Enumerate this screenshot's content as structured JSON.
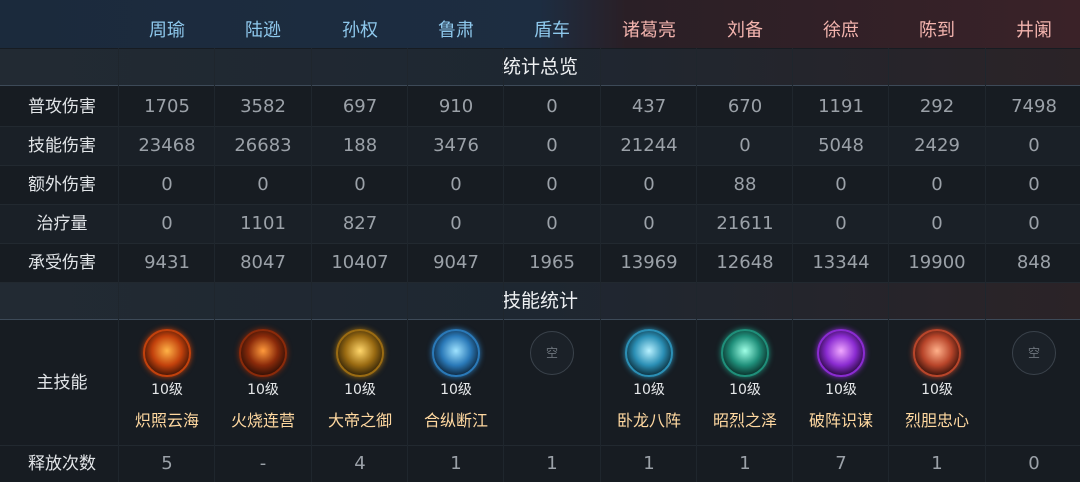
{
  "generals": [
    {
      "name": "周瑜",
      "side": "wei"
    },
    {
      "name": "陆逊",
      "side": "wei"
    },
    {
      "name": "孙权",
      "side": "wei"
    },
    {
      "name": "鲁肃",
      "side": "wei"
    },
    {
      "name": "盾车",
      "side": "wei"
    },
    {
      "name": "诸葛亮",
      "side": "shu"
    },
    {
      "name": "刘备",
      "side": "shu"
    },
    {
      "name": "徐庶",
      "side": "shu"
    },
    {
      "name": "陈到",
      "side": "shu"
    },
    {
      "name": "井阑",
      "side": "shu"
    }
  ],
  "sections": {
    "overview": "统计总览",
    "skills": "技能统计"
  },
  "stats": [
    {
      "label": "普攻伤害",
      "values": [
        "1705",
        "3582",
        "697",
        "910",
        "0",
        "437",
        "670",
        "1191",
        "292",
        "7498"
      ]
    },
    {
      "label": "技能伤害",
      "values": [
        "23468",
        "26683",
        "188",
        "3476",
        "0",
        "21244",
        "0",
        "5048",
        "2429",
        "0"
      ]
    },
    {
      "label": "额外伤害",
      "values": [
        "0",
        "0",
        "0",
        "0",
        "0",
        "0",
        "88",
        "0",
        "0",
        "0"
      ]
    },
    {
      "label": "治疗量",
      "values": [
        "0",
        "1101",
        "827",
        "0",
        "0",
        "0",
        "21611",
        "0",
        "0",
        "0"
      ]
    },
    {
      "label": "承受伤害",
      "values": [
        "9431",
        "8047",
        "10407",
        "9047",
        "1965",
        "13969",
        "12648",
        "13344",
        "19900",
        "848"
      ]
    }
  ],
  "main_skill": {
    "label": "主技能",
    "skills": [
      {
        "icon": "fire-vortex-icon",
        "level": "10级",
        "name": "炽照云海",
        "empty": false,
        "colors": [
          "#ffb347",
          "#c2410c",
          "#3a1206"
        ]
      },
      {
        "icon": "burning-camp-icon",
        "level": "10级",
        "name": "火烧连营",
        "empty": false,
        "colors": [
          "#ff9a3c",
          "#8a2a0a",
          "#2a0e06"
        ]
      },
      {
        "icon": "emperor-guard-icon",
        "level": "10级",
        "name": "大帝之御",
        "empty": false,
        "colors": [
          "#ffd66b",
          "#9a6b12",
          "#2d2008"
        ]
      },
      {
        "icon": "alliance-diamond-icon",
        "level": "10级",
        "name": "合纵断江",
        "empty": false,
        "colors": [
          "#9fe3ff",
          "#2a79b8",
          "#0d2236"
        ]
      },
      {
        "icon": "empty-slot-icon",
        "level": "",
        "name": "",
        "empty": true,
        "empty_text": "空"
      },
      {
        "icon": "sleeping-dragon-icon",
        "level": "10级",
        "name": "卧龙八阵",
        "empty": false,
        "colors": [
          "#b8f1ff",
          "#2b8fb5",
          "#0b2a36"
        ]
      },
      {
        "icon": "zhaolie-blessing-icon",
        "level": "10级",
        "name": "昭烈之泽",
        "empty": false,
        "colors": [
          "#9fffe6",
          "#1f8f7a",
          "#0a2a26"
        ]
      },
      {
        "icon": "insight-eye-icon",
        "level": "10级",
        "name": "破阵识谋",
        "empty": false,
        "colors": [
          "#f0a8ff",
          "#8a2bd1",
          "#26093a"
        ]
      },
      {
        "icon": "loyal-heart-icon",
        "level": "10级",
        "name": "烈胆忠心",
        "empty": false,
        "colors": [
          "#ffb08a",
          "#b8452a",
          "#34100a"
        ]
      },
      {
        "icon": "empty-slot-icon",
        "level": "",
        "name": "",
        "empty": true,
        "empty_text": "空"
      }
    ]
  },
  "release_count": {
    "label": "释放次数",
    "values": [
      "5",
      "-",
      "4",
      "1",
      "1",
      "1",
      "1",
      "7",
      "1",
      "0"
    ]
  }
}
